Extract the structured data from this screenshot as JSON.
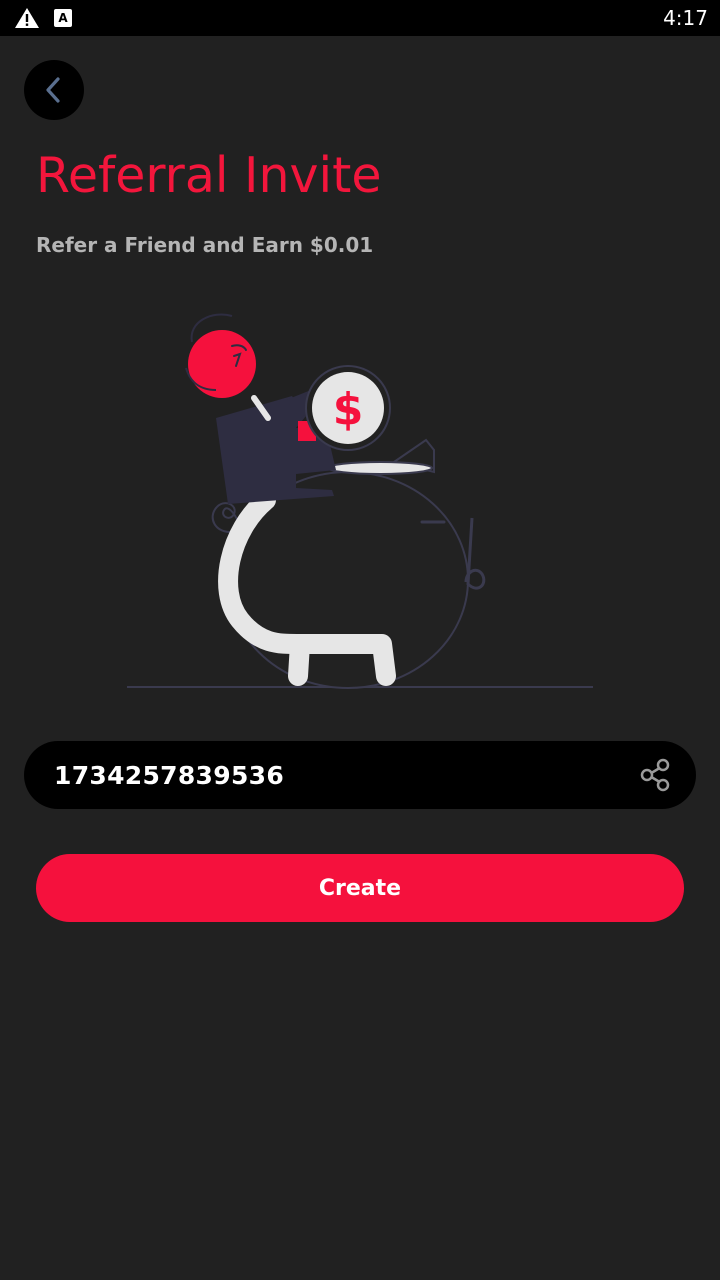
{
  "status_bar": {
    "time": "4:17",
    "icons": [
      "alert-icon",
      "app-notification-icon"
    ],
    "app_icon_letter": "A"
  },
  "header": {
    "back_icon": "chevron-left-icon",
    "title": "Referral Invite",
    "subtitle": "Refer a Friend and Earn $0.01"
  },
  "illustration": {
    "name": "person-depositing-coin-into-piggy-bank",
    "coin_symbol": "$"
  },
  "referral": {
    "code": "1734257839536",
    "share_icon": "share-icon"
  },
  "actions": {
    "create_label": "Create"
  },
  "colors": {
    "background": "#212121",
    "accent": "#f5113d",
    "title": "#f3163c",
    "subtitle": "#b5b5b5",
    "field": "#000000"
  }
}
